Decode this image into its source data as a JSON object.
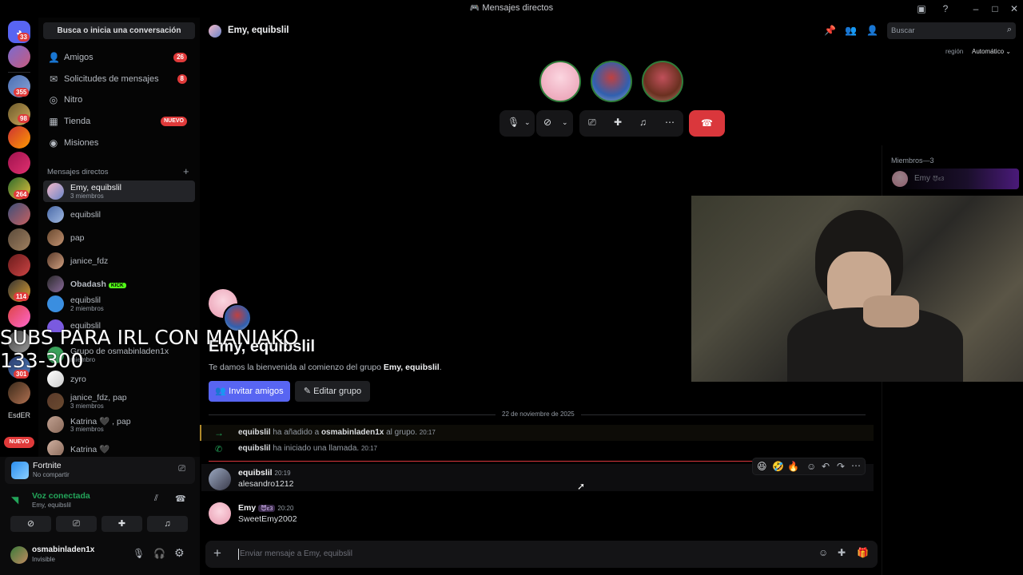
{
  "window": {
    "title": "Mensajes directos"
  },
  "servers": {
    "badges": [
      "33",
      "355",
      "98",
      "264",
      "114",
      "301"
    ],
    "text_item": "EsdER",
    "new_label": "NUEVO"
  },
  "sidebar": {
    "search_placeholder": "Busca o inicia una conversación",
    "nav": [
      {
        "label": "Amigos",
        "badge": "26",
        "icon": "friends-icon"
      },
      {
        "label": "Solicitudes de mensajes",
        "badge": "8",
        "icon": "mail-icon"
      },
      {
        "label": "Nitro",
        "badge": "",
        "icon": "nitro-icon"
      },
      {
        "label": "Tienda",
        "badge": "NUEVO",
        "icon": "shop-icon"
      },
      {
        "label": "Misiones",
        "badge": "",
        "icon": "quests-icon"
      }
    ],
    "dm_header": "Mensajes directos",
    "dms": [
      {
        "name": "Emy, equibslil",
        "sub": "3 miembros"
      },
      {
        "name": "equibslil",
        "sub": ""
      },
      {
        "name": "pap",
        "sub": ""
      },
      {
        "name": "janice_fdz",
        "sub": ""
      },
      {
        "name": "Obadash",
        "sub": "",
        "tag": "KICK"
      },
      {
        "name": "equibslil",
        "sub": "2 miembros"
      },
      {
        "name": "equibslil",
        "sub": ""
      },
      {
        "name": "Grupo de osmabinladen1x",
        "sub": "miembro"
      },
      {
        "name": "zyro",
        "sub": ""
      },
      {
        "name": "janice_fdz, pap",
        "sub": "3 miembros"
      },
      {
        "name": "Katrina 🖤 , pap",
        "sub": "3 miembros"
      },
      {
        "name": "Katrina 🖤",
        "sub": ""
      }
    ]
  },
  "activity": {
    "game": "Fortnite",
    "game_sub": "No compartir",
    "voice_status": "Voz conectada",
    "voice_channel": "Emy, equibslil"
  },
  "user": {
    "name": "osmabinladen1x",
    "status": "Invisible"
  },
  "overlay": {
    "line1": "SUBS PARA IRL CON MANIAKO",
    "line2": "133-300"
  },
  "header": {
    "title": "Emy, equibslil",
    "search_placeholder": "Buscar",
    "region_label": "región",
    "region_value": "Automático"
  },
  "members": {
    "header": "Miembros—3",
    "first": "Emy",
    "first_tag": "😈ε3"
  },
  "chat": {
    "group_title": "Emy, equibslil",
    "welcome_prefix": "Te damos la bienvenida al comienzo del grupo ",
    "welcome_group": "Emy, equibslil",
    "welcome_suffix": ".",
    "invite_label": "Invitar amigos",
    "edit_label": "Editar grupo",
    "date_divider": "22 de noviembre de 2025",
    "system": [
      {
        "actor": "equibslil",
        "text1": " ha añadido a ",
        "target": "osmabinladen1x",
        "text2": " al grupo.",
        "time": "20:17"
      },
      {
        "actor": "equibslil",
        "text1": " ha iniciado una llamada.",
        "target": "",
        "text2": "",
        "time": "20:17"
      }
    ],
    "messages": [
      {
        "author": "equibslil",
        "tag": "",
        "time": "20:19",
        "text": "alesandro1212"
      },
      {
        "author": "Emy",
        "tag": "😈ε3",
        "time": "20:20",
        "text": "SweetEmy2002"
      }
    ],
    "hover_reactions": [
      "😆",
      "🤣",
      "🔥"
    ],
    "input_placeholder": "Enviar mensaje a Emy, equibslil"
  },
  "colors": {
    "accent": "#5865f2",
    "danger": "#da373c",
    "online": "#23a55a"
  }
}
